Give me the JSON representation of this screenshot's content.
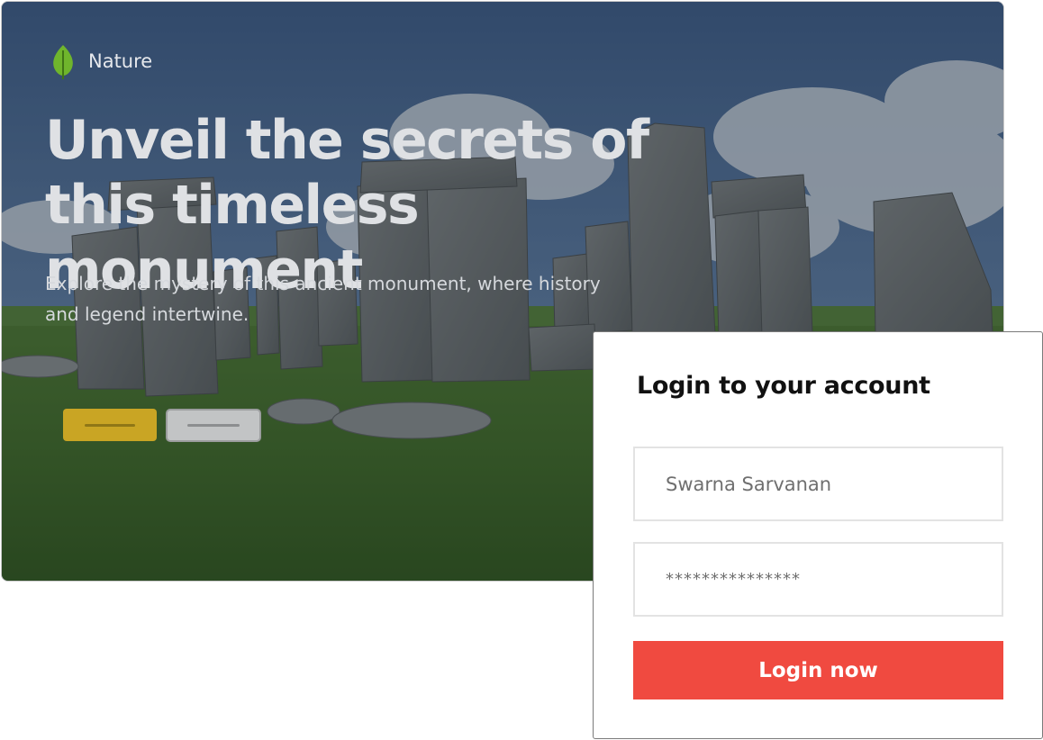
{
  "brand": {
    "name": "Nature",
    "icon": "leaf-icon",
    "icon_color": "#6fb52c"
  },
  "hero": {
    "headline": "Unveil the secrets of this timeless monument",
    "subtext": "Explore the mystery of this ancient monument, where history and legend intertwine.",
    "primary_button_color": "#c9a524",
    "secondary_button_color": "#c2c4c5"
  },
  "login": {
    "title": "Login  to your account",
    "username_value": "Swarna Sarvanan",
    "password_value": "***************",
    "submit_label": "Login now",
    "submit_color": "#f04a40"
  }
}
